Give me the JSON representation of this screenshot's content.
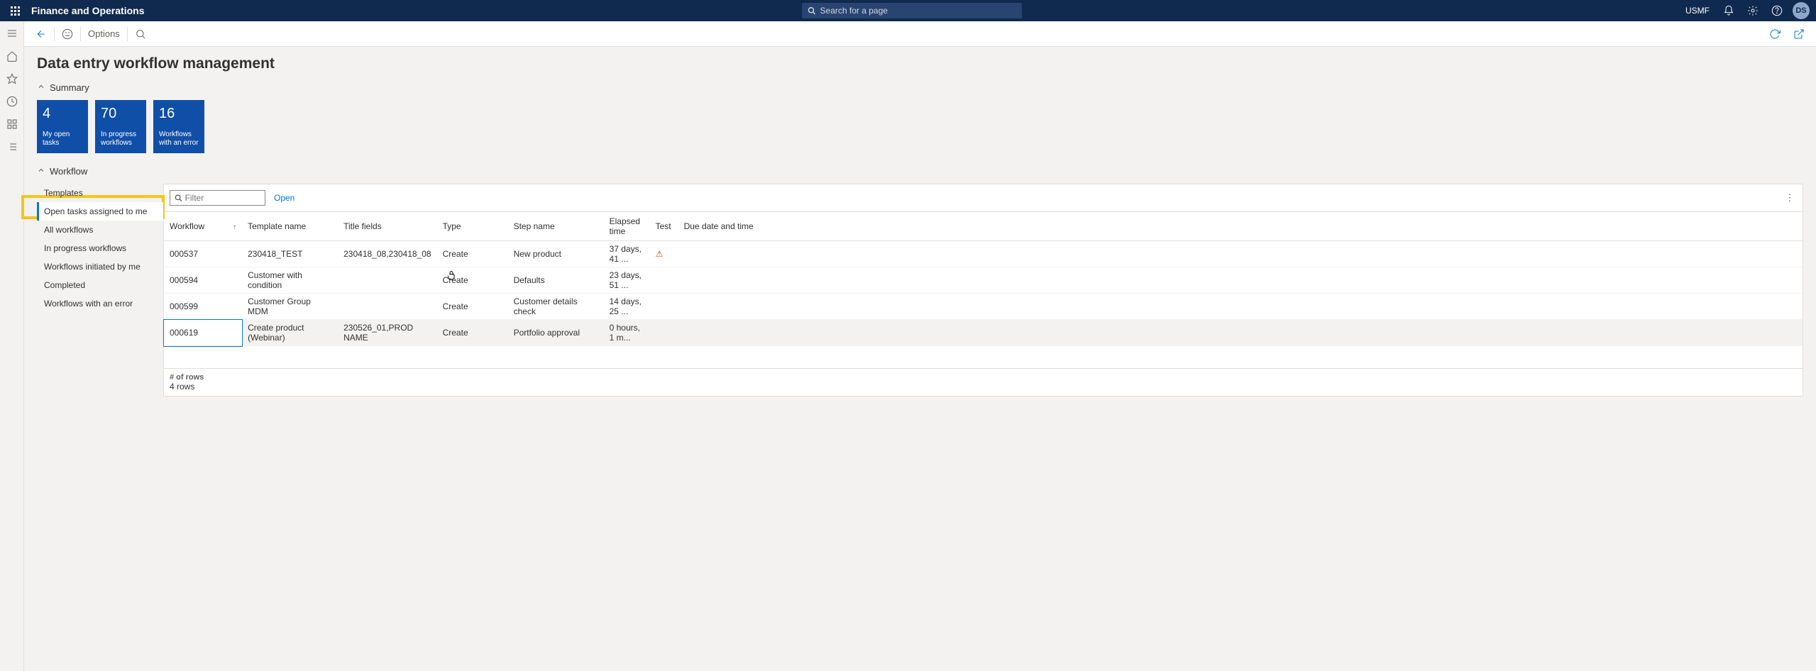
{
  "header": {
    "app_title": "Finance and Operations",
    "search_placeholder": "Search for a page",
    "company": "USMF",
    "avatar": "DS"
  },
  "actionbar": {
    "options": "Options"
  },
  "page": {
    "title": "Data entry workflow management"
  },
  "summary": {
    "label": "Summary",
    "tiles": [
      {
        "num": "4",
        "label": "My open tasks"
      },
      {
        "num": "70",
        "label": "In progress workflows"
      },
      {
        "num": "16",
        "label": "Workflows with an error"
      }
    ]
  },
  "workflow_section": {
    "label": "Workflow"
  },
  "side_nav": {
    "items": [
      "Templates",
      "Open tasks assigned to me",
      "All workflows",
      "In progress workflows",
      "Workflows initiated by me",
      "Completed",
      "Workflows with an error"
    ],
    "selected_index": 1
  },
  "grid": {
    "filter_placeholder": "Filter",
    "open_label": "Open",
    "columns": {
      "workflow": "Workflow",
      "template": "Template name",
      "title_fields": "Title fields",
      "type": "Type",
      "step": "Step name",
      "elapsed": "Elapsed time",
      "test": "Test",
      "due": "Due date and time"
    },
    "rows": [
      {
        "workflow": "000537",
        "template": "230418_TEST",
        "title_fields": "230418_08,230418_08",
        "type": "Create",
        "step": "New product",
        "elapsed": "37 days, 41 ...",
        "test": "⚠",
        "due": ""
      },
      {
        "workflow": "000594",
        "template": "Customer with condition",
        "title_fields": "",
        "type": "Create",
        "step": "Defaults",
        "elapsed": "23 days, 51 ...",
        "test": "",
        "due": ""
      },
      {
        "workflow": "000599",
        "template": "Customer Group MDM",
        "title_fields": "",
        "type": "Create",
        "step": "Customer details check",
        "elapsed": "14 days, 25 ...",
        "test": "",
        "due": ""
      },
      {
        "workflow": "000619",
        "template": "Create product (Webinar)",
        "title_fields": "230526_01,PROD NAME",
        "type": "Create",
        "step": "Portfolio approval",
        "elapsed": "0 hours, 1 m...",
        "test": "",
        "due": ""
      }
    ],
    "footer_label": "# of rows",
    "footer_count": "4 rows"
  }
}
